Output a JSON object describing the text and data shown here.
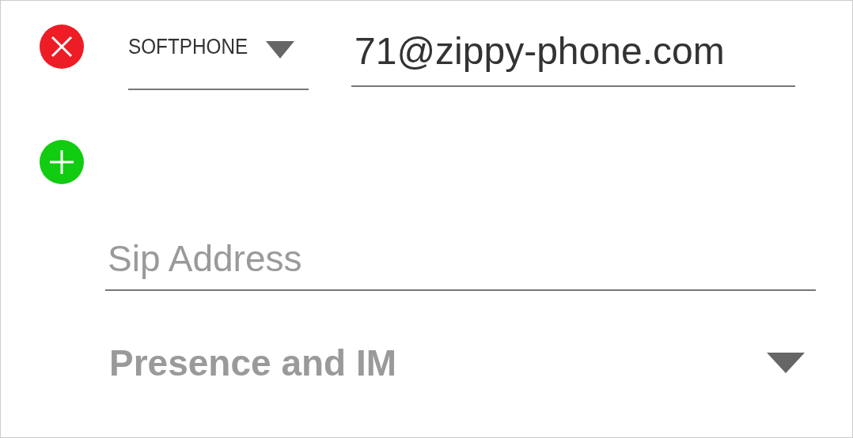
{
  "entries": [
    {
      "kind": "existing",
      "type": "SOFTPHONE",
      "address": "71@zippy-phone.com"
    }
  ],
  "sip_address": {
    "placeholder": "Sip Address"
  },
  "section": {
    "title": "Presence and IM"
  }
}
